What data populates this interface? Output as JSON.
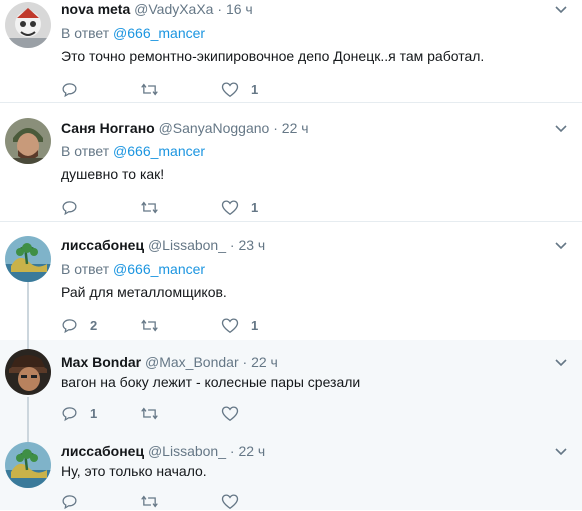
{
  "tweets": [
    {
      "name": "nova meta",
      "handle": "@VadyXaXa",
      "dot": "·",
      "time": "16 ч",
      "reply_prefix": "В ответ",
      "reply_mention": "@666_mancer",
      "text": "Это точно ремонтно-экипировочное депо Донецк..я там работал.",
      "replies": "",
      "retweets": "",
      "likes": "1"
    },
    {
      "name": "Саня Ноггано",
      "handle": "@SanyaNoggano",
      "dot": "·",
      "time": "22 ч",
      "reply_prefix": "В ответ",
      "reply_mention": "@666_mancer",
      "text": "душевно то как!",
      "replies": "",
      "retweets": "",
      "likes": "1"
    },
    {
      "name": "лиссабонец",
      "handle": "@Lissabon_",
      "dot": "·",
      "time": "23 ч",
      "reply_prefix": "В ответ",
      "reply_mention": "@666_mancer",
      "text": "Рай для металломщиков.",
      "replies": "2",
      "retweets": "",
      "likes": "1"
    },
    {
      "name": "Max Bondar",
      "handle": "@Max_Bondar",
      "dot": "·",
      "time": "22 ч",
      "text": "вагон на боку лежит - колесные пары срезали",
      "replies": "1",
      "retweets": "",
      "likes": ""
    },
    {
      "name": "лиссабонец",
      "handle": "@Lissabon_",
      "dot": "·",
      "time": "22 ч",
      "text": "Ну, это только начало.",
      "replies": "",
      "retweets": "",
      "likes": ""
    }
  ],
  "colors": {
    "link": "#1b95e0",
    "secondary": "#657786",
    "divider": "#e6ecf0",
    "thread_line": "#ccd6dd",
    "reply_bg": "#f5f8fa"
  },
  "icons": [
    "reply-icon",
    "retweet-icon",
    "like-icon",
    "caret-down-icon"
  ]
}
